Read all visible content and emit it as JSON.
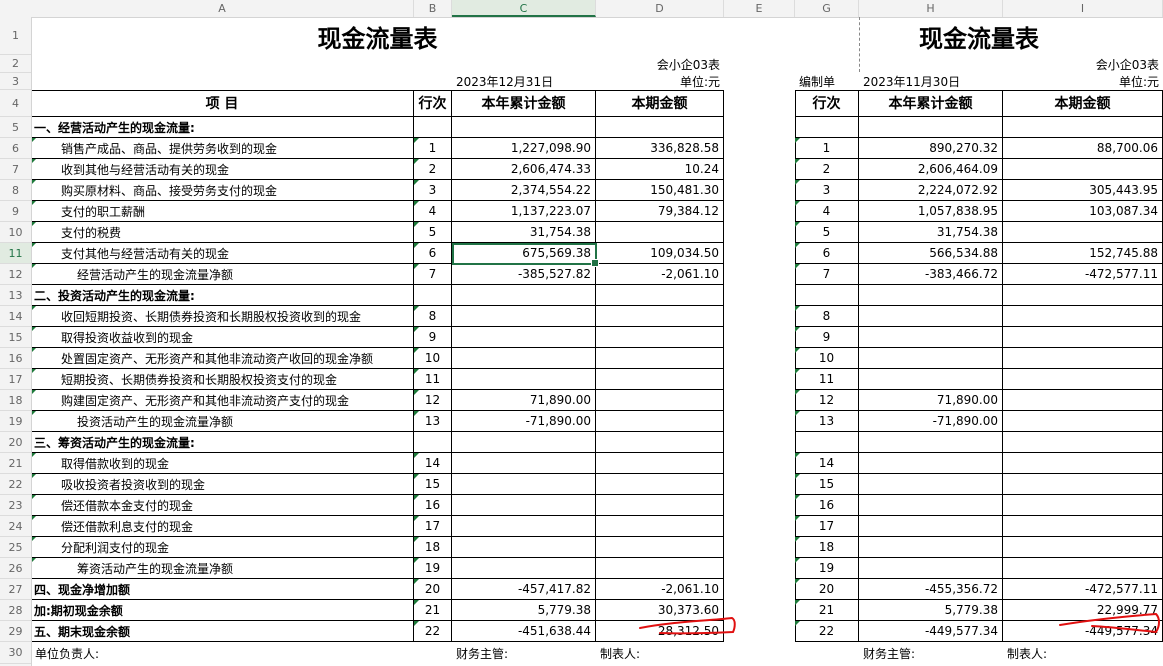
{
  "columns": [
    "A",
    "B",
    "C",
    "D",
    "E",
    "G",
    "H",
    "I"
  ],
  "selected_column": "C",
  "rows": [
    "1",
    "2",
    "3",
    "4",
    "5",
    "6",
    "7",
    "8",
    "9",
    "10",
    "11",
    "12",
    "13",
    "14",
    "15",
    "16",
    "17",
    "18",
    "19",
    "20",
    "21",
    "22",
    "23",
    "24",
    "25",
    "26",
    "27",
    "28",
    "29",
    "30"
  ],
  "selected_row": "11",
  "left": {
    "title": "现金流量表",
    "form_code": "会小企03表",
    "date": "2023年12月31日",
    "unit": "单位:元",
    "headers": {
      "item": "项 目",
      "line": "行次",
      "ytd": "本年累计金额",
      "period": "本期金额"
    },
    "selected_cell_value": "675,569.38"
  },
  "right": {
    "title": "现金流量表",
    "form_code": "会小企03表",
    "prepared_by_label": "编制单",
    "date": "2023年11月30日",
    "unit": "单位:元",
    "headers": {
      "line": "行次",
      "ytd": "本年累计金额",
      "period": "本期金额"
    }
  },
  "table_rows": [
    {
      "item": "一、经营活动产生的现金流量:",
      "bold": true,
      "indent": 0,
      "line": "",
      "l_ytd": "",
      "l_per": "",
      "r_ytd": "",
      "r_per": ""
    },
    {
      "item": "销售产成品、商品、提供劳务收到的现金",
      "bold": false,
      "indent": 1,
      "line": "1",
      "l_ytd": "1,227,098.90",
      "l_per": "336,828.58",
      "r_ytd": "890,270.32",
      "r_per": "88,700.06"
    },
    {
      "item": "收到其他与经营活动有关的现金",
      "bold": false,
      "indent": 1,
      "line": "2",
      "l_ytd": "2,606,474.33",
      "l_per": "10.24",
      "r_ytd": "2,606,464.09",
      "r_per": ""
    },
    {
      "item": "购买原材料、商品、接受劳务支付的现金",
      "bold": false,
      "indent": 1,
      "line": "3",
      "l_ytd": "2,374,554.22",
      "l_per": "150,481.30",
      "r_ytd": "2,224,072.92",
      "r_per": "305,443.95"
    },
    {
      "item": "支付的职工薪酬",
      "bold": false,
      "indent": 1,
      "line": "4",
      "l_ytd": "1,137,223.07",
      "l_per": "79,384.12",
      "r_ytd": "1,057,838.95",
      "r_per": "103,087.34"
    },
    {
      "item": "支付的税费",
      "bold": false,
      "indent": 1,
      "line": "5",
      "l_ytd": "31,754.38",
      "l_per": "",
      "r_ytd": "31,754.38",
      "r_per": ""
    },
    {
      "item": "支付其他与经营活动有关的现金",
      "bold": false,
      "indent": 1,
      "line": "6",
      "l_ytd": "675,569.38",
      "l_per": "109,034.50",
      "r_ytd": "566,534.88",
      "r_per": "152,745.88"
    },
    {
      "item": "经营活动产生的现金流量净额",
      "bold": false,
      "indent": 2,
      "line": "7",
      "l_ytd": "-385,527.82",
      "l_per": "-2,061.10",
      "r_ytd": "-383,466.72",
      "r_per": "-472,577.11"
    },
    {
      "item": "二、投资活动产生的现金流量:",
      "bold": true,
      "indent": 0,
      "line": "",
      "l_ytd": "",
      "l_per": "",
      "r_ytd": "",
      "r_per": ""
    },
    {
      "item": "收回短期投资、长期债券投资和长期股权投资收到的现金",
      "bold": false,
      "indent": 1,
      "line": "8",
      "l_ytd": "",
      "l_per": "",
      "r_ytd": "",
      "r_per": ""
    },
    {
      "item": "取得投资收益收到的现金",
      "bold": false,
      "indent": 1,
      "line": "9",
      "l_ytd": "",
      "l_per": "",
      "r_ytd": "",
      "r_per": ""
    },
    {
      "item": "处置固定资产、无形资产和其他非流动资产收回的现金净额",
      "bold": false,
      "indent": 1,
      "line": "10",
      "l_ytd": "",
      "l_per": "",
      "r_ytd": "",
      "r_per": ""
    },
    {
      "item": "短期投资、长期债券投资和长期股权投资支付的现金",
      "bold": false,
      "indent": 1,
      "line": "11",
      "l_ytd": "",
      "l_per": "",
      "r_ytd": "",
      "r_per": ""
    },
    {
      "item": "购建固定资产、无形资产和其他非流动资产支付的现金",
      "bold": false,
      "indent": 1,
      "line": "12",
      "l_ytd": "71,890.00",
      "l_per": "",
      "r_ytd": "71,890.00",
      "r_per": ""
    },
    {
      "item": "投资活动产生的现金流量净额",
      "bold": false,
      "indent": 2,
      "line": "13",
      "l_ytd": "-71,890.00",
      "l_per": "",
      "r_ytd": "-71,890.00",
      "r_per": ""
    },
    {
      "item": "三、筹资活动产生的现金流量:",
      "bold": true,
      "indent": 0,
      "line": "",
      "l_ytd": "",
      "l_per": "",
      "r_ytd": "",
      "r_per": ""
    },
    {
      "item": "取得借款收到的现金",
      "bold": false,
      "indent": 1,
      "line": "14",
      "l_ytd": "",
      "l_per": "",
      "r_ytd": "",
      "r_per": ""
    },
    {
      "item": "吸收投资者投资收到的现金",
      "bold": false,
      "indent": 1,
      "line": "15",
      "l_ytd": "",
      "l_per": "",
      "r_ytd": "",
      "r_per": ""
    },
    {
      "item": "偿还借款本金支付的现金",
      "bold": false,
      "indent": 1,
      "line": "16",
      "l_ytd": "",
      "l_per": "",
      "r_ytd": "",
      "r_per": ""
    },
    {
      "item": "偿还借款利息支付的现金",
      "bold": false,
      "indent": 1,
      "line": "17",
      "l_ytd": "",
      "l_per": "",
      "r_ytd": "",
      "r_per": ""
    },
    {
      "item": "分配利润支付的现金",
      "bold": false,
      "indent": 1,
      "line": "18",
      "l_ytd": "",
      "l_per": "",
      "r_ytd": "",
      "r_per": ""
    },
    {
      "item": "筹资活动产生的现金流量净额",
      "bold": false,
      "indent": 2,
      "line": "19",
      "l_ytd": "",
      "l_per": "",
      "r_ytd": "",
      "r_per": ""
    },
    {
      "item": "四、现金净增加额",
      "bold": true,
      "indent": 0,
      "line": "20",
      "l_ytd": "-457,417.82",
      "l_per": "-2,061.10",
      "r_ytd": "-455,356.72",
      "r_per": "-472,577.11"
    },
    {
      "item": "加:期初现金余额",
      "bold": true,
      "indent": 0,
      "line": "21",
      "l_ytd": "5,779.38",
      "l_per": "30,373.60",
      "r_ytd": "5,779.38",
      "r_per": "22,999.77"
    },
    {
      "item": "五、期末现金余额",
      "bold": true,
      "indent": 0,
      "line": "22",
      "l_ytd": "-451,638.44",
      "l_per": "28,312.50",
      "r_ytd": "-449,577.34",
      "r_per": "-449,577.34"
    }
  ],
  "footer": {
    "unit_head": "单位负责人:",
    "finance_head": "财务主管:",
    "preparer": "制表人:",
    "finance_head_right": "财务主管:",
    "preparer_right": "制表人:"
  },
  "colors": {
    "grid_line": "#000000",
    "selection": "#217346",
    "flag": "#1d7a3a",
    "ink": "#e01010"
  }
}
